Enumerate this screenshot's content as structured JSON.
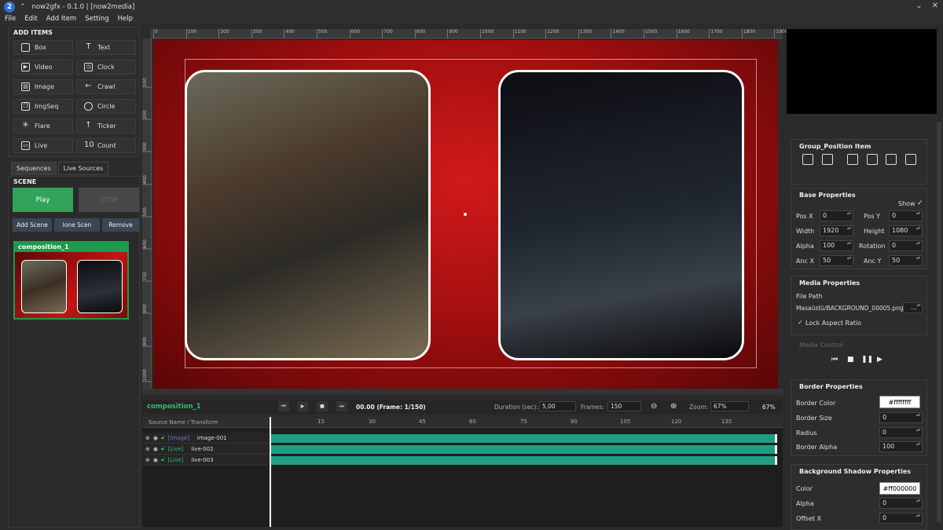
{
  "window": {
    "title": "now2gfx - 0.1.0 | [now2media]",
    "logo": "2",
    "minimize": "⌄",
    "close": "✕"
  },
  "menu": [
    "File",
    "Edit",
    "Add Item",
    "Setting",
    "Help"
  ],
  "add_items": {
    "title": "ADD ITEMS",
    "buttons": [
      {
        "label": "Box",
        "icon": "box-icon",
        "glyph": ""
      },
      {
        "label": "Text",
        "icon": "text-icon",
        "glyph": "T"
      },
      {
        "label": "Video",
        "icon": "video-icon",
        "glyph": "▶"
      },
      {
        "label": "Clock",
        "icon": "clock-icon",
        "glyph": "◷"
      },
      {
        "label": "Image",
        "icon": "image-icon",
        "glyph": "▨"
      },
      {
        "label": "Crawl",
        "icon": "crawl-icon",
        "glyph": "←"
      },
      {
        "label": "ImgSeq",
        "icon": "image-sequence-icon",
        "glyph": "❐"
      },
      {
        "label": "Circle",
        "icon": "circle-icon",
        "glyph": ""
      },
      {
        "label": "Flare",
        "icon": "flare-icon",
        "glyph": "✳"
      },
      {
        "label": "Ticker",
        "icon": "ticker-icon",
        "glyph": "↑"
      },
      {
        "label": "Live",
        "icon": "live-camera-icon",
        "glyph": "▭"
      },
      {
        "label": "Count",
        "icon": "count-icon",
        "glyph": "10"
      }
    ]
  },
  "tabs": [
    "Sequences",
    "Live Sources"
  ],
  "scene": {
    "title": "SCENE",
    "play": "Play",
    "stop": "STOP",
    "add": "Add Scene",
    "clone": "lone Scen",
    "remove": "Remove",
    "composition": "composition_1"
  },
  "ruler_top": [
    "0",
    "100",
    "200",
    "300",
    "400",
    "500",
    "600",
    "700",
    "800",
    "900",
    "1000",
    "1100",
    "1200",
    "1300",
    "1400",
    "1500",
    "1600",
    "1700",
    "1800",
    "1900"
  ],
  "ruler_left": [
    "100",
    "200",
    "300",
    "400",
    "500",
    "600",
    "700",
    "800",
    "900",
    "1000"
  ],
  "timeline": {
    "composition": "composition_1",
    "time": "00.00 (Frame: 1/150)",
    "duration_label": "Duration (sec):",
    "duration": "5,00",
    "frames_label": "Frames:",
    "frames": "150",
    "zoom_label": "Zoom:",
    "zoom": "67%",
    "zoom_readout": "67%",
    "source_header": "Source Name / Transform",
    "ticks": [
      "15",
      "30",
      "45",
      "60",
      "75",
      "90",
      "105",
      "120",
      "135"
    ],
    "tracks": [
      {
        "type": "[Image]",
        "name": "image-001"
      },
      {
        "type": "[Live]",
        "name": "live-002"
      },
      {
        "type": "[Live]",
        "name": "live-003"
      }
    ]
  },
  "props": {
    "group_title": "Group_Position Item",
    "base_title": "Base Properties",
    "show_label": "Show",
    "show_check": "✓",
    "fields": [
      {
        "l1": "Pos X",
        "v1": "0",
        "l2": "Pos Y",
        "v2": "0"
      },
      {
        "l1": "Width",
        "v1": "1920",
        "l2": "Height",
        "v2": "1080"
      },
      {
        "l1": "Alpha",
        "v1": "100",
        "l2": "Rotation",
        "v2": "0"
      },
      {
        "l1": "Anc X",
        "v1": "50",
        "l2": "Anc Y",
        "v2": "50"
      }
    ],
    "media_title": "Media Properties",
    "file_path_label": "File Path",
    "file_path": "Masaüstü/BACKGROUND_00005.png",
    "browse": "...",
    "lock_check": "✓",
    "lock_label": "Lock Aspect Ratio",
    "media_control": "Media Control",
    "border_title": "Border Properties",
    "border_color_label": "Border Color",
    "border_color": "#ffffffff",
    "border_size_label": "Border Size",
    "border_size": "0",
    "radius_label": "Radius",
    "radius": "0",
    "border_alpha_label": "Border Alpha",
    "border_alpha": "100",
    "shadow_title": "Background Shadow Properties",
    "shadow_color_label": "Color",
    "shadow_color": "#ff000000",
    "shadow_alpha_label": "Alpha",
    "shadow_alpha": "0",
    "shadow_offx_label": "Offset X",
    "shadow_offx": "0"
  },
  "colors": {
    "accent_green": "#31a35a",
    "track_teal": "#1f9e82",
    "canvas_red": "#c41414"
  }
}
